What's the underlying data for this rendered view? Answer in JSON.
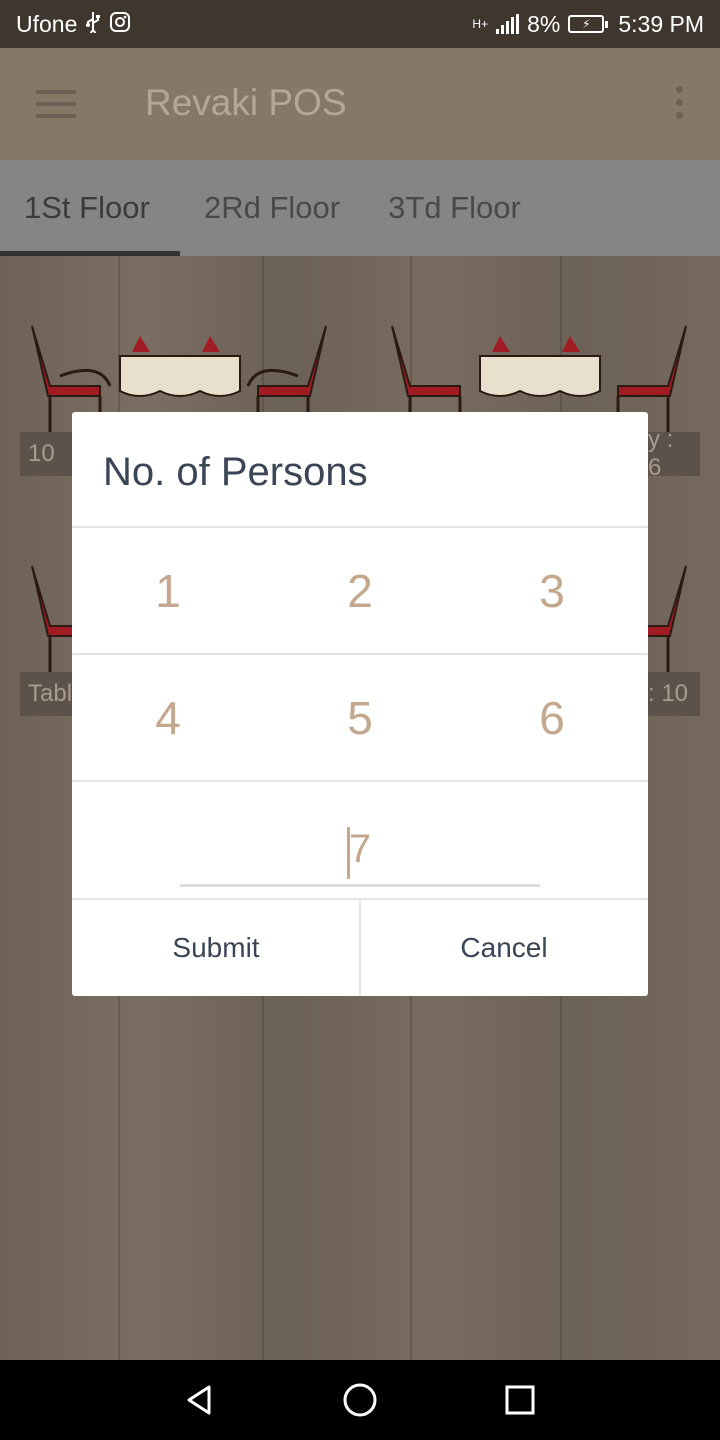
{
  "status_bar": {
    "carrier": "Ufone",
    "usb_icon": "usb-icon",
    "instagram_icon": "instagram-icon",
    "network_type": "H+",
    "battery_percent": "8%",
    "time": "5:39 PM"
  },
  "app_bar": {
    "title": "Revaki POS",
    "menu_icon": "hamburger-icon",
    "overflow_icon": "more-vertical-icon"
  },
  "tabs": [
    {
      "label": "1St Floor",
      "active": true
    },
    {
      "label": "2Rd Floor",
      "active": false
    },
    {
      "label": "3Td Floor",
      "active": false
    }
  ],
  "tables_background": {
    "row1_left_caption": "10",
    "row1_right_caption": "y : 6",
    "row2_left_caption": "Tabl",
    "row2_right_caption": ": 10"
  },
  "dialog": {
    "title": "No. of Persons",
    "numbers_row1": [
      "1",
      "2",
      "3"
    ],
    "numbers_row2": [
      "4",
      "5",
      "6"
    ],
    "input_value": "7",
    "submit_label": "Submit",
    "cancel_label": "Cancel"
  },
  "nav_bar": {
    "back_icon": "back-triangle-icon",
    "home_icon": "home-circle-icon",
    "recents_icon": "recents-square-icon"
  },
  "colors": {
    "accent": "#c4a88d",
    "dialog_text": "#3a4556",
    "status_bar": "#3f362e"
  }
}
